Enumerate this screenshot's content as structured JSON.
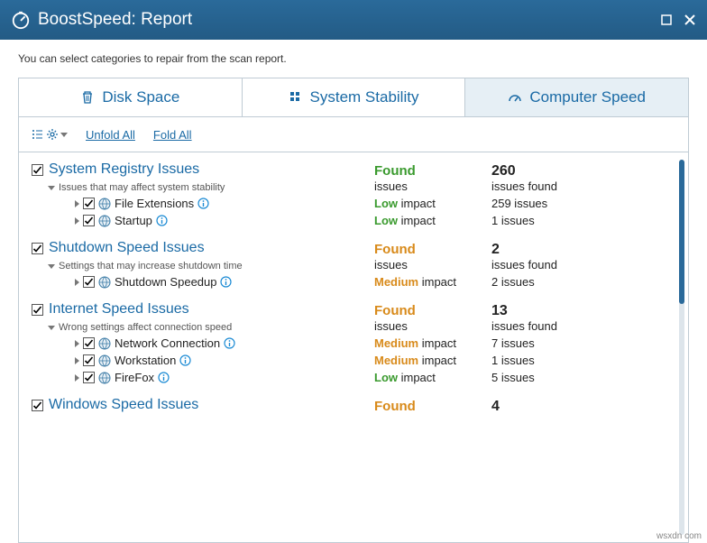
{
  "title": "BoostSpeed: Report",
  "instruction": "You can select categories to repair from the scan report.",
  "tabs": {
    "disk": "Disk Space",
    "stability": "System Stability",
    "speed": "Computer Speed"
  },
  "toolbar": {
    "unfold": "Unfold All",
    "fold": "Fold All"
  },
  "labels": {
    "issues": "issues",
    "issues_found": "issues found",
    "impact": " impact",
    "issues_suffix": " issues"
  },
  "groups": [
    {
      "name": "System Registry Issues",
      "desc": "Issues that may affect system stability",
      "found": "Found",
      "found_class": "green",
      "count": "260",
      "items": [
        {
          "name": "File Extensions",
          "impact": "Low",
          "impact_class": "green",
          "count": "259"
        },
        {
          "name": "Startup",
          "impact": "Low",
          "impact_class": "green",
          "count": "1"
        }
      ]
    },
    {
      "name": "Shutdown Speed Issues",
      "desc": "Settings that may increase shutdown time",
      "found": "Found",
      "found_class": "orange",
      "count": "2",
      "items": [
        {
          "name": "Shutdown Speedup",
          "impact": "Medium",
          "impact_class": "orange",
          "count": "2"
        }
      ]
    },
    {
      "name": "Internet Speed Issues",
      "desc": "Wrong settings affect connection speed",
      "found": "Found",
      "found_class": "orange",
      "count": "13",
      "items": [
        {
          "name": "Network Connection",
          "impact": "Medium",
          "impact_class": "orange",
          "count": "7"
        },
        {
          "name": "Workstation",
          "impact": "Medium",
          "impact_class": "orange",
          "count": "1"
        },
        {
          "name": "FireFox",
          "impact": "Low",
          "impact_class": "green",
          "count": "5"
        }
      ]
    },
    {
      "name": "Windows Speed Issues",
      "desc": "",
      "found": "Found",
      "found_class": "orange",
      "count": "4",
      "items": []
    }
  ],
  "footer": "wsxdn com"
}
